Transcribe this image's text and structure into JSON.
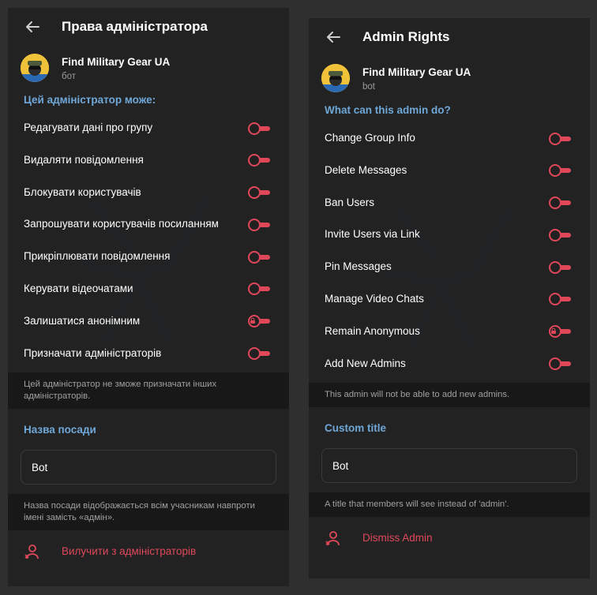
{
  "colors": {
    "background": "#2f2f2f",
    "panel": "#212121",
    "accent_blue": "#6fa8d8",
    "danger_red": "#e0485a",
    "muted_text": "#a0a0a0"
  },
  "left": {
    "header": {
      "title": "Права адміністратора",
      "back_icon": "arrow-left-icon"
    },
    "bot": {
      "name": "Find Military Gear UA",
      "subtitle": "бот"
    },
    "section_title": "Цей адміністратор може:",
    "permissions": [
      {
        "label": "Редагувати дані про групу",
        "state": "off",
        "locked": false
      },
      {
        "label": "Видаляти повідомлення",
        "state": "off",
        "locked": false
      },
      {
        "label": "Блокувати користувачів",
        "state": "off",
        "locked": false
      },
      {
        "label": "Запрошувати користувачів посиланням",
        "state": "off",
        "locked": false
      },
      {
        "label": "Прикріплювати повідомлення",
        "state": "off",
        "locked": false
      },
      {
        "label": "Керувати відеочатами",
        "state": "off",
        "locked": false
      },
      {
        "label": "Залишатися анонімним",
        "state": "off",
        "locked": true
      },
      {
        "label": "Призначати адміністраторів",
        "state": "off",
        "locked": false
      }
    ],
    "permissions_note": "Цей адміністратор не зможе призначати інших адміністраторів.",
    "custom_title_label": "Назва посади",
    "custom_title_value": "Bot",
    "custom_title_note": "Назва посади відображається всім учасникам навпроти імені замість «адмін».",
    "dismiss_label": "Вилучити з адміністраторів",
    "dismiss_icon": "remove-user-icon"
  },
  "right": {
    "header": {
      "title": "Admin Rights",
      "back_icon": "arrow-left-icon"
    },
    "bot": {
      "name": "Find Military Gear UA",
      "subtitle": "bot"
    },
    "section_title": "What can this admin do?",
    "permissions": [
      {
        "label": "Change Group Info",
        "state": "off",
        "locked": false
      },
      {
        "label": "Delete Messages",
        "state": "off",
        "locked": false
      },
      {
        "label": "Ban Users",
        "state": "off",
        "locked": false
      },
      {
        "label": "Invite Users via Link",
        "state": "off",
        "locked": false
      },
      {
        "label": "Pin Messages",
        "state": "off",
        "locked": false
      },
      {
        "label": "Manage Video Chats",
        "state": "off",
        "locked": false
      },
      {
        "label": "Remain Anonymous",
        "state": "off",
        "locked": true
      },
      {
        "label": "Add New Admins",
        "state": "off",
        "locked": false
      }
    ],
    "permissions_note": "This admin will not be able to add new admins.",
    "custom_title_label": "Custom title",
    "custom_title_value": "Bot",
    "custom_title_note": "A title that members will see instead of 'admin'.",
    "dismiss_label": "Dismiss Admin",
    "dismiss_icon": "remove-user-icon"
  }
}
